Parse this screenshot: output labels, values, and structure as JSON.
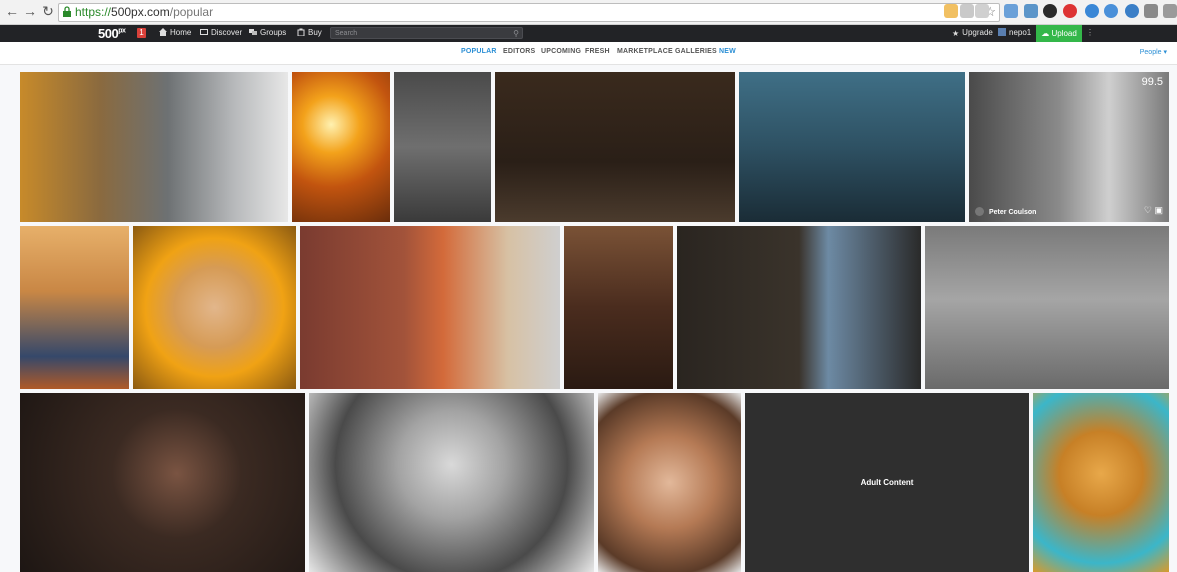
{
  "browser": {
    "url_protocol": "https://",
    "url_host": "500px.com",
    "url_path": "/popular",
    "nav_icons": [
      "back-icon",
      "forward-icon",
      "reload-icon"
    ],
    "extension_icons": [
      "zoom-icon",
      "translate-icon",
      "bookmark-star-icon",
      "camera-icon",
      "extension-icon",
      "circle-extension-icon",
      "abp-icon",
      "download-icon",
      "sync-icon",
      "globe-icon",
      "puzzle-icon",
      "profile-icon"
    ]
  },
  "site": {
    "logo": "500",
    "logo_sup": "px",
    "notification_count": "1",
    "nav": [
      {
        "label": "Home",
        "icon": "home-icon"
      },
      {
        "label": "Discover",
        "icon": "discover-icon"
      },
      {
        "label": "Groups",
        "icon": "groups-icon"
      },
      {
        "label": "Buy",
        "icon": "buy-icon"
      }
    ],
    "search_placeholder": "Search",
    "upgrade_label": "Upgrade",
    "user_label": "nepo1",
    "upload_label": "Upload",
    "brand_color": "#34b74a",
    "accent_color": "#2b8fd5"
  },
  "subnav": {
    "tabs": [
      {
        "label": "POPULAR",
        "active": true
      },
      {
        "label": "EDITORS"
      },
      {
        "label": "UPCOMING"
      },
      {
        "label": "FRESH"
      },
      {
        "label": "MARKETPLACE"
      },
      {
        "label": "GALLERIES"
      }
    ],
    "new_label": "NEW",
    "people_label": "People"
  },
  "gallery": {
    "highlight": {
      "score": "99.5",
      "author": "Peter Coulson"
    },
    "adult_label": "Adult Content"
  }
}
